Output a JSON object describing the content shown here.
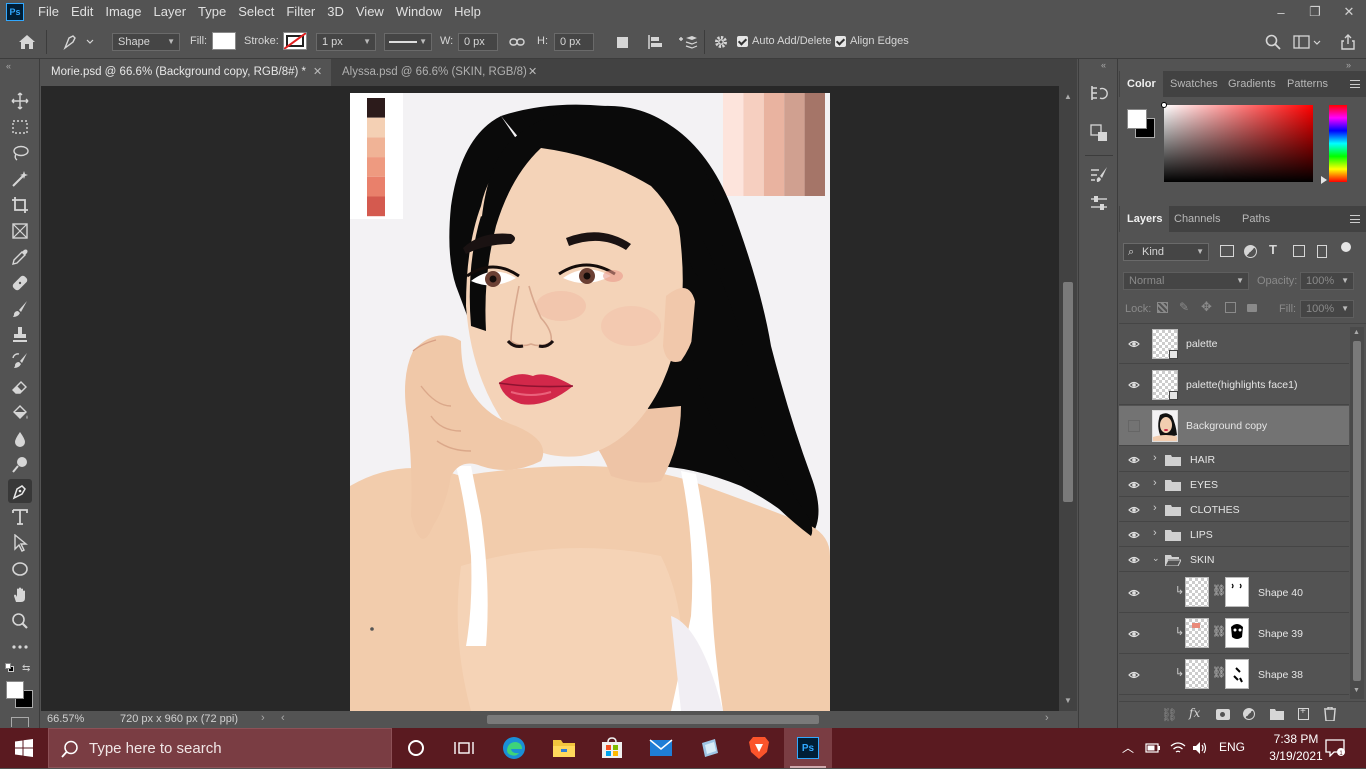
{
  "app": {
    "logo": "Ps"
  },
  "menu": [
    "File",
    "Edit",
    "Image",
    "Layer",
    "Type",
    "Select",
    "Filter",
    "3D",
    "View",
    "Window",
    "Help"
  ],
  "window_controls": {
    "minimize": "–",
    "restore": "❐",
    "close": "✕"
  },
  "options_bar": {
    "mode_value": "Shape",
    "fill_label": "Fill:",
    "stroke_label": "Stroke:",
    "stroke_width": "1 px",
    "w_label": "W:",
    "w_value": "0 px",
    "h_label": "H:",
    "h_value": "0 px",
    "auto_add_delete": "Auto Add/Delete",
    "auto_add_delete_checked": true,
    "align_edges": "Align Edges",
    "align_edges_checked": true
  },
  "doc_tabs": [
    {
      "title": "Morie.psd @ 66.6% (Background copy, RGB/8#) *",
      "active": true
    },
    {
      "title": "Alyssa.psd @ 66.6% (SKIN, RGB/8)",
      "active": false
    }
  ],
  "status": {
    "zoom": "66.57%",
    "doc_info": "720 px x 960 px (72 ppi)"
  },
  "swatch_palettes": {
    "left": [
      "#2c1b1b",
      "#f4d0b4",
      "#f0b396",
      "#ee9a80",
      "#e9806b",
      "#d45a4f"
    ],
    "right": [
      "#fde4dc",
      "#f6cfc0",
      "#e9b3a0",
      "#d0a090",
      "#a57568"
    ]
  },
  "color_panel": {
    "tabs": [
      "Color",
      "Swatches",
      "Gradients",
      "Patterns"
    ],
    "active_tab": "Color",
    "foreground": "#ffffff",
    "background": "#000000",
    "hue_color": "#ff0000"
  },
  "layers_panel": {
    "tabs": [
      "Layers",
      "Channels",
      "Paths"
    ],
    "active_tab": "Layers",
    "filter_kind": "Kind",
    "blend_mode": "Normal",
    "opacity_label": "Opacity:",
    "opacity_value": "100%",
    "lock_label": "Lock:",
    "fill_label": "Fill:",
    "fill_value": "100%",
    "layers": [
      {
        "name": "palette",
        "type": "smart",
        "visible": true,
        "selected": false
      },
      {
        "name": "palette(highlights face1)",
        "type": "smart",
        "visible": true,
        "selected": false
      },
      {
        "name": "Background copy",
        "type": "image",
        "visible": false,
        "selected": true
      },
      {
        "name": "HAIR",
        "type": "group",
        "visible": true,
        "selected": false
      },
      {
        "name": "EYES",
        "type": "group",
        "visible": true,
        "selected": false
      },
      {
        "name": "CLOTHES",
        "type": "group",
        "visible": true,
        "selected": false
      },
      {
        "name": "LIPS",
        "type": "group",
        "visible": true,
        "selected": false
      },
      {
        "name": "SKIN",
        "type": "group-open",
        "visible": true,
        "selected": false
      },
      {
        "name": "Shape 40",
        "type": "masked-shape",
        "visible": true,
        "selected": false
      },
      {
        "name": "Shape 39",
        "type": "masked-shape",
        "visible": true,
        "selected": false
      },
      {
        "name": "Shape 38",
        "type": "masked-shape",
        "visible": true,
        "selected": false
      }
    ]
  },
  "taskbar": {
    "search_placeholder": "Type here to search",
    "apps": [
      "task-view",
      "edge",
      "file-explorer",
      "store",
      "mail",
      "notes",
      "brave",
      "photoshop"
    ],
    "language": "ENG",
    "time": "7:38 PM",
    "date": "3/19/2021"
  }
}
